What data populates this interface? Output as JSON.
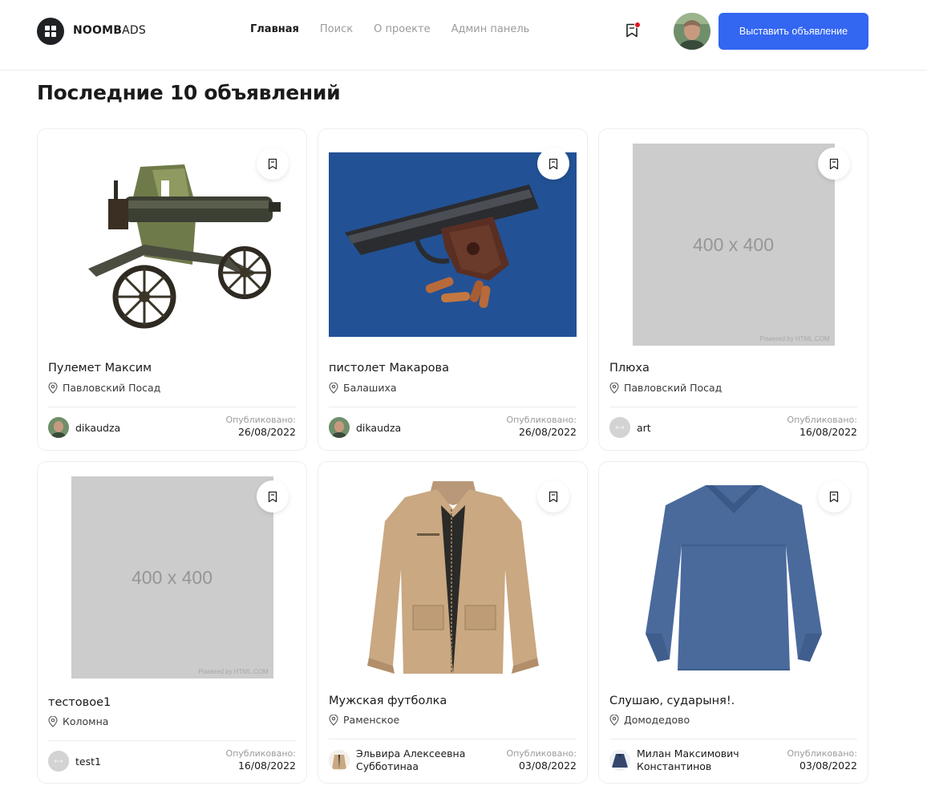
{
  "header": {
    "logo": "NOOMBADS",
    "logo_bold": "NOOMB",
    "logo_rest": "ADS",
    "nav": [
      {
        "label": "Главная",
        "active": true
      },
      {
        "label": "Поиск",
        "active": false
      },
      {
        "label": "О проекте",
        "active": false
      },
      {
        "label": "Админ панель",
        "active": false
      }
    ],
    "post_button": "Выставить объявление",
    "fav_icon": "bookmark-icon",
    "has_notification": true
  },
  "page_title": "Последние 10 объявлений",
  "colors": {
    "accent": "#3366f1",
    "notification": "#e3121b"
  },
  "cards": [
    {
      "title": "Пулемет Максим",
      "location": "Павловский Посад",
      "author": "dikaudza",
      "author_line2": "",
      "published_label": "Опубликовано:",
      "date": "26/08/2022",
      "image": "machine-gun"
    },
    {
      "title": "пистолет Макарова",
      "location": "Балашиха",
      "author": "dikaudza",
      "author_line2": "",
      "published_label": "Опубликовано:",
      "date": "26/08/2022",
      "image": "pistol"
    },
    {
      "title": "Плюха",
      "location": "Павловский Посад",
      "author": "art",
      "author_line2": "",
      "published_label": "Опубликовано:",
      "date": "16/08/2022",
      "image": "placeholder",
      "placeholder_text": "400 x 400",
      "placeholder_credit": "Powered by HTML.COM"
    },
    {
      "title": "тестовое1",
      "location": "Коломна",
      "author": "test1",
      "author_line2": "",
      "published_label": "Опубликовано:",
      "date": "16/08/2022",
      "image": "placeholder",
      "placeholder_text": "400 x 400",
      "placeholder_credit": "Powered by HTML.COM"
    },
    {
      "title": "Мужская футболка",
      "location": "Раменское",
      "author": "Эльвира Алексеевна",
      "author_line2": "Субботинаа",
      "published_label": "Опубликовано:",
      "date": "03/08/2022",
      "image": "jacket"
    },
    {
      "title": "Слушаю, сударыня!.",
      "location": "Домодедово",
      "author": "Милан Максимович",
      "author_line2": "Константинов",
      "published_label": "Опубликовано:",
      "date": "03/08/2022",
      "image": "sweater"
    }
  ]
}
